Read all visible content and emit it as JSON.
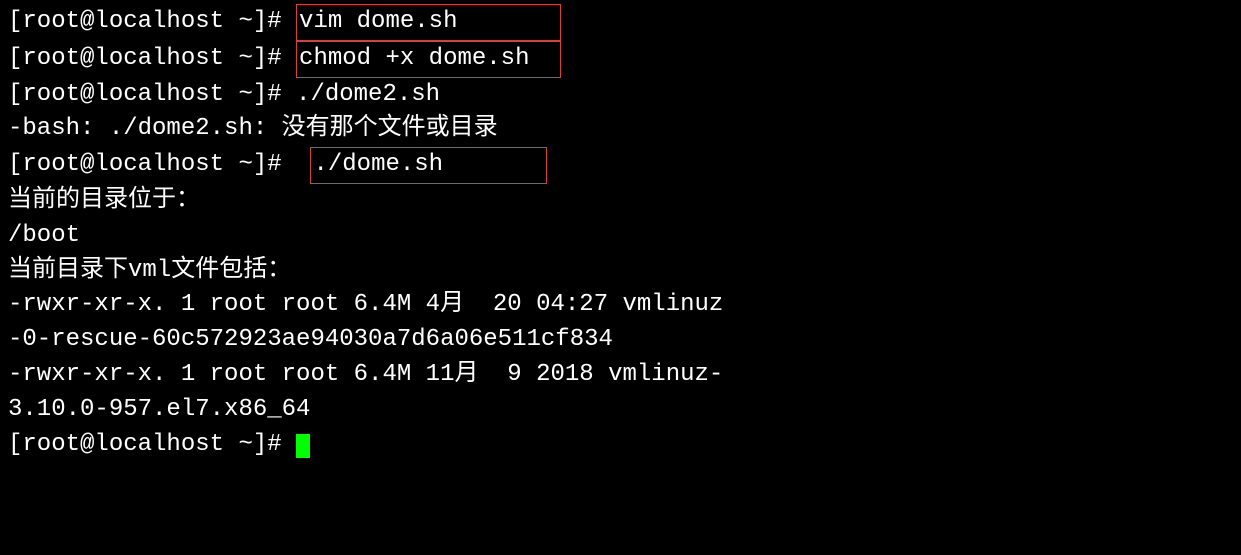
{
  "prompt": "[root@localhost ~]# ",
  "cmd1": "vim dome.sh       ",
  "cmd2": "chmod +x dome.sh  ",
  "cmd3": "./dome2.sh",
  "err": "-bash: ./dome2.sh: 没有那个文件或目录",
  "cmd4_space": " ",
  "cmd4": "./dome.sh       ",
  "out1": "当前的目录位于：",
  "out2": "/boot",
  "out3": "当前目录下vml文件包括：",
  "file1a": "-rwxr-xr-x. 1 root root 6.4M 4月  20 04:27 vmlinuz",
  "file1b": "-0-rescue-60c572923ae94030a7d6a06e511cf834",
  "file2a": "-rwxr-xr-x. 1 root root 6.4M 11月  9 2018 vmlinuz-",
  "file2b": "3.10.0-957.el7.x86_64",
  "promptcut": "[root@localhost ~]# "
}
